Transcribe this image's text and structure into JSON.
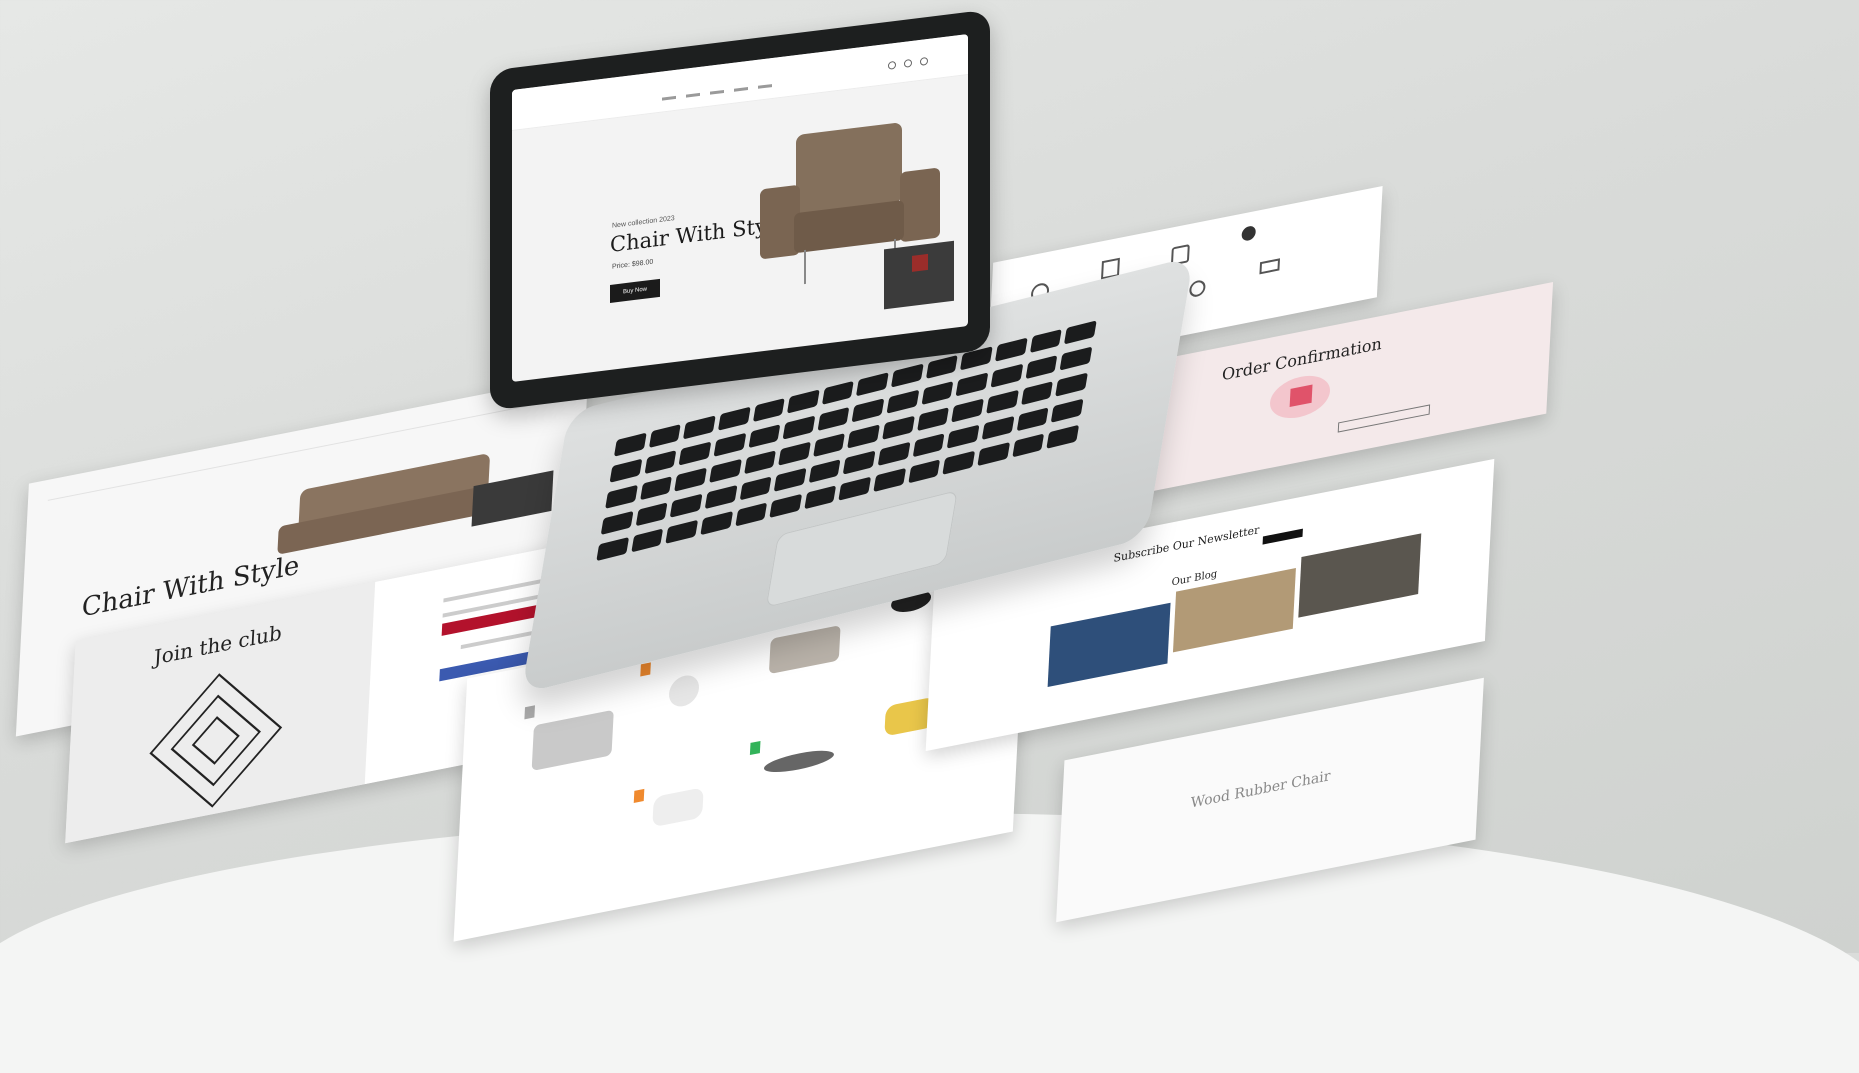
{
  "laptop": {
    "hero_sub": "New collection 2023",
    "hero_title": "Chair With Style",
    "hero_price": "Price: $98.00",
    "hero_button": "Buy Now"
  },
  "hero_left": {
    "title": "Chair With Style"
  },
  "join": {
    "title": "Join the club"
  },
  "order": {
    "title": "Order Confirmation"
  },
  "newsletter": {
    "title": "Subscribe Our Newsletter"
  },
  "blog": {
    "title": "Our Blog"
  },
  "bottom_card": {
    "title": "Wood Rubber Chair"
  }
}
